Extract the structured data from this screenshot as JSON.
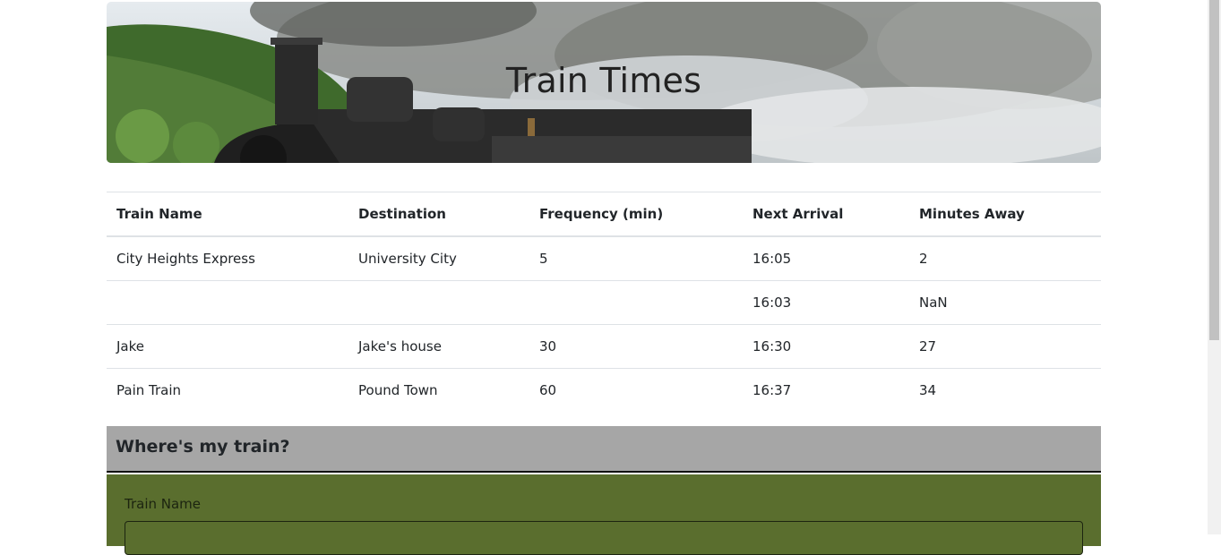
{
  "header": {
    "title": "Train Times"
  },
  "table": {
    "columns": [
      "Train Name",
      "Destination",
      "Frequency (min)",
      "Next Arrival",
      "Minutes Away"
    ],
    "rows": [
      [
        "City Heights Express",
        "University City",
        "5",
        "16:05",
        "2"
      ],
      [
        "",
        "",
        "",
        "16:03",
        "NaN"
      ],
      [
        "Jake",
        "Jake's house",
        "30",
        "16:30",
        "27"
      ],
      [
        "Pain Train",
        "Pound Town",
        "60",
        "16:37",
        "34"
      ]
    ]
  },
  "form": {
    "heading": "Where's my train?",
    "train_name_label": "Train Name",
    "train_name_value": ""
  }
}
